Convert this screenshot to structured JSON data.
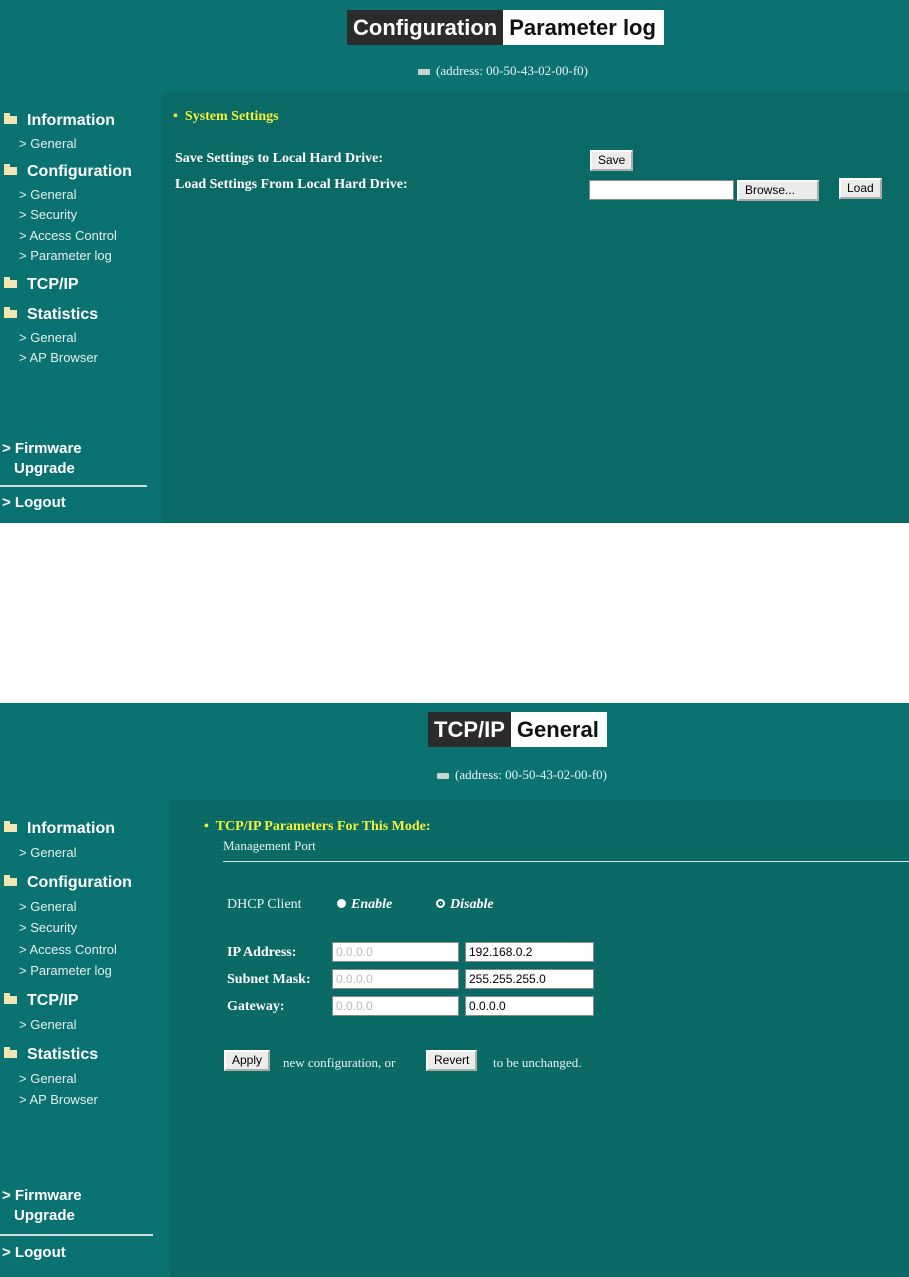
{
  "shot1": {
    "title": {
      "section": "Configuration",
      "page": "Parameter log"
    },
    "address": "(address: 00-50-43-02-00-f0)",
    "sidebar": {
      "information": {
        "label": "Information",
        "items": [
          "> General"
        ]
      },
      "configuration": {
        "label": "Configuration",
        "items": [
          "> General",
          "> Security",
          "> Access Control",
          "> Parameter log"
        ]
      },
      "tcpip": {
        "label": "TCP/IP",
        "items": []
      },
      "statistics": {
        "label": "Statistics",
        "items": [
          "> General",
          "> AP Browser"
        ]
      },
      "firmware_line1": "> Firmware",
      "firmware_line2": "Upgrade",
      "logout": "> Logout"
    },
    "main": {
      "heading": "System Settings",
      "save_label": "Save Settings to Local Hard Drive:",
      "load_label": "Load Settings From Local Hard Drive:",
      "save_button": "Save",
      "browse_button": "Browse...",
      "load_button": "Load",
      "file_value": ""
    }
  },
  "shot2": {
    "title": {
      "section": "TCP/IP",
      "page": "General"
    },
    "address": "(address: 00-50-43-02-00-f0)",
    "sidebar": {
      "information": {
        "label": "Information",
        "items": [
          "> General"
        ]
      },
      "configuration": {
        "label": "Configuration",
        "items": [
          "> General",
          "> Security",
          "> Access Control",
          "> Parameter log"
        ]
      },
      "tcpip": {
        "label": "TCP/IP",
        "items": [
          "> General"
        ]
      },
      "statistics": {
        "label": "Statistics",
        "items": [
          "> General",
          "> AP Browser"
        ]
      },
      "firmware_line1": "> Firmware",
      "firmware_line2": "Upgrade",
      "logout": "> Logout"
    },
    "main": {
      "heading": "TCP/IP Parameters For This Mode:",
      "subheading": "Management Port",
      "dhcp_label": "DHCP Client",
      "enable_label": "Enable",
      "disable_label": "Disable",
      "dhcp_selected": "Disable",
      "ip_label": "IP Address:",
      "subnet_label": "Subnet Mask:",
      "gateway_label": "Gateway:",
      "ip_current": "0.0.0.0",
      "ip_value": "192.168.0.2",
      "subnet_current": "0.0.0.0",
      "subnet_value": "255.255.255.0",
      "gateway_current": "0.0.0.0",
      "gateway_value": "0.0.0.0",
      "apply_button": "Apply",
      "middle_text": "new configuration, or",
      "revert_button": "Revert",
      "end_text": "to be unchanged."
    }
  }
}
